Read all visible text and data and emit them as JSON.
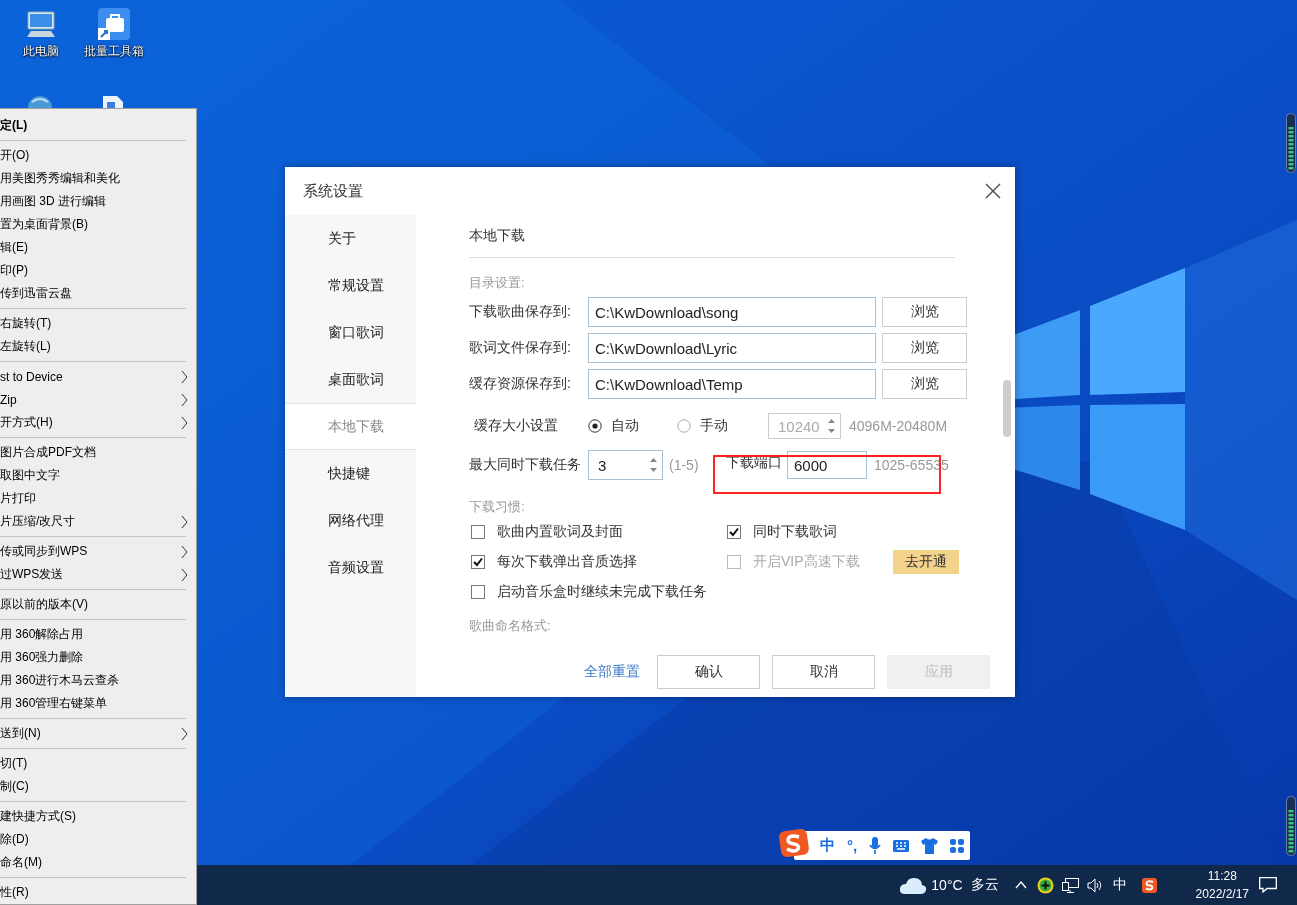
{
  "desktop_icons": [
    {
      "kind": "computer",
      "label": "此电脑"
    },
    {
      "kind": "toolbox",
      "label": "批量工具箱"
    },
    {
      "kind": "globe"
    },
    {
      "kind": "document"
    }
  ],
  "context_menu": {
    "groups": [
      {
        "items": [
          {
            "label": "定(L)",
            "default": true,
            "submenu": false
          }
        ]
      },
      {
        "items": [
          {
            "label": "开(O)",
            "default": false,
            "submenu": false
          },
          {
            "label": "用美图秀秀编辑和美化",
            "default": false,
            "submenu": false
          },
          {
            "label": "用画图 3D 进行编辑",
            "default": false,
            "submenu": false
          },
          {
            "label": "置为桌面背景(B)",
            "default": false,
            "submenu": false
          },
          {
            "label": "辑(E)",
            "default": false,
            "submenu": false
          },
          {
            "label": "印(P)",
            "default": false,
            "submenu": false
          },
          {
            "label": "传到迅雷云盘",
            "default": false,
            "submenu": false
          }
        ]
      },
      {
        "items": [
          {
            "label": "右旋转(T)",
            "default": false,
            "submenu": false
          },
          {
            "label": "左旋转(L)",
            "default": false,
            "submenu": false
          }
        ]
      },
      {
        "items": [
          {
            "label": "st to Device",
            "default": false,
            "submenu": true
          },
          {
            "label": "Zip",
            "default": false,
            "submenu": true
          },
          {
            "label": "开方式(H)",
            "default": false,
            "submenu": true
          }
        ]
      },
      {
        "items": [
          {
            "label": "图片合成PDF文档",
            "default": false,
            "submenu": false
          },
          {
            "label": "取图中文字",
            "default": false,
            "submenu": false
          },
          {
            "label": "片打印",
            "default": false,
            "submenu": false
          },
          {
            "label": "片压缩/改尺寸",
            "default": false,
            "submenu": true
          }
        ]
      },
      {
        "items": [
          {
            "label": "传或同步到WPS",
            "default": false,
            "submenu": true
          },
          {
            "label": "过WPS发送",
            "default": false,
            "submenu": true
          }
        ]
      },
      {
        "items": [
          {
            "label": "原以前的版本(V)",
            "default": false,
            "submenu": false
          }
        ]
      },
      {
        "items": [
          {
            "label": "用 360解除占用",
            "default": false,
            "submenu": false
          },
          {
            "label": "用 360强力删除",
            "default": false,
            "submenu": false
          },
          {
            "label": "用 360进行木马云查杀",
            "default": false,
            "submenu": false
          },
          {
            "label": "用 360管理右键菜单",
            "default": false,
            "submenu": false
          }
        ]
      },
      {
        "items": [
          {
            "label": "送到(N)",
            "default": false,
            "submenu": true
          }
        ]
      },
      {
        "items": [
          {
            "label": "切(T)",
            "default": false,
            "submenu": false
          },
          {
            "label": "制(C)",
            "default": false,
            "submenu": false
          }
        ]
      },
      {
        "items": [
          {
            "label": "建快捷方式(S)",
            "default": false,
            "submenu": false
          },
          {
            "label": "除(D)",
            "default": false,
            "submenu": false
          },
          {
            "label": "命名(M)",
            "default": false,
            "submenu": false
          }
        ]
      },
      {
        "items": [
          {
            "label": "性(R)",
            "default": false,
            "submenu": false
          }
        ]
      }
    ]
  },
  "dialog": {
    "title": "系统设置",
    "sidebar": [
      {
        "label": "关于",
        "selected": false
      },
      {
        "label": "常规设置",
        "selected": false
      },
      {
        "label": "窗口歌词",
        "selected": false
      },
      {
        "label": "桌面歌词",
        "selected": false
      },
      {
        "label": "本地下载",
        "selected": true
      },
      {
        "label": "快捷键",
        "selected": false
      },
      {
        "label": "网络代理",
        "selected": false
      },
      {
        "label": "音频设置",
        "selected": false
      }
    ],
    "section_title": "本地下载",
    "directory": {
      "heading": "目录设置:",
      "rows": [
        {
          "label": "下载歌曲保存到:",
          "value": "C:\\KwDownload\\song",
          "button": "浏览"
        },
        {
          "label": "歌词文件保存到:",
          "value": "C:\\KwDownload\\Lyric",
          "button": "浏览"
        },
        {
          "label": "缓存资源保存到:",
          "value": "C:\\KwDownload\\Temp",
          "button": "浏览"
        }
      ]
    },
    "cache": {
      "label": "缓存大小设置",
      "options": [
        {
          "label": "自动",
          "selected": true
        },
        {
          "label": "手动",
          "selected": false
        }
      ],
      "size": {
        "value": "10240",
        "disabled": true
      },
      "range": "4096M-20480M"
    },
    "tasks": {
      "label": "最大同时下载任务",
      "value": "3",
      "range": "(1-5)"
    },
    "port": {
      "label": "下载端口",
      "value": "6000",
      "range": "1025-65535",
      "highlighted": true
    },
    "habits": {
      "heading": "下载习惯:",
      "options": [
        {
          "label": "歌曲内置歌词及封面",
          "checked": false,
          "disabled": false
        },
        {
          "label": "同时下载歌词",
          "checked": true,
          "disabled": false
        },
        {
          "label": "每次下载弹出音质选择",
          "checked": true,
          "disabled": false
        },
        {
          "label": "开启VIP高速下载",
          "checked": false,
          "disabled": true,
          "button": "去开通"
        },
        {
          "label": "启动音乐盒时继续未完成下载任务",
          "checked": false,
          "disabled": false
        }
      ]
    },
    "naming": {
      "heading": "歌曲命名格式:"
    },
    "footer": {
      "reset_link": "全部重置",
      "buttons": [
        {
          "label": "确认",
          "disabled": false
        },
        {
          "label": "取消",
          "disabled": false
        },
        {
          "label": "应用",
          "disabled": true
        }
      ]
    }
  },
  "ime_bar": {
    "mode": "中",
    "punctuation": "°,"
  },
  "taskbar": {
    "temperature": "10°C",
    "weather": "多云",
    "input_mode": "中",
    "time": "11:28",
    "date": "2022/2/17"
  }
}
